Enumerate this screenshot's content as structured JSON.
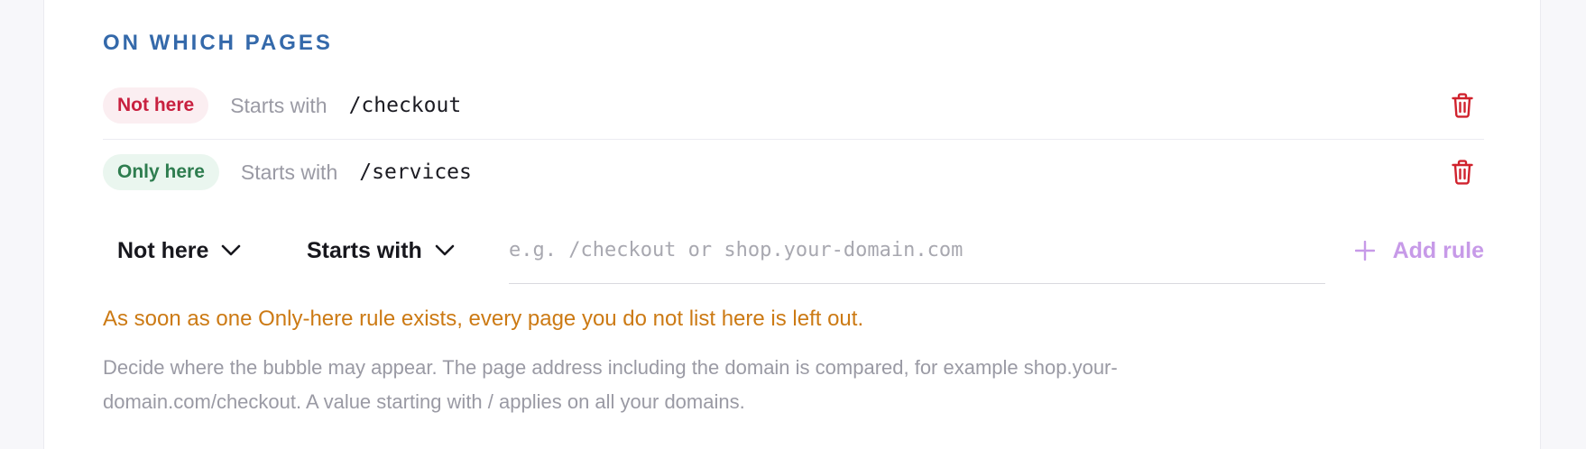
{
  "section": {
    "title": "ON WHICH PAGES"
  },
  "rules": [
    {
      "mode": "Not here",
      "operator": "Starts with",
      "value": "/checkout",
      "delete_icon": "trash-icon"
    },
    {
      "mode": "Only here",
      "operator": "Starts with",
      "value": "/services",
      "delete_icon": "trash-icon"
    }
  ],
  "new_rule": {
    "mode_selected": "Not here",
    "operator_selected": "Starts with",
    "placeholder": "e.g. /checkout or shop.your-domain.com",
    "value": "",
    "add_label": "Add rule",
    "add_icon": "plus-icon",
    "chevron_icon": "chevron-down-icon"
  },
  "warning": "As soon as one Only-here rule exists, every page you do not list here is left out.",
  "help_text": "Decide where the bubble may appear. The page address including the domain is compared, for example shop.your-domain.com/checkout. A value starting with / applies on all your domains.",
  "colors": {
    "title": "#3469aa",
    "not_here": "#c8203f",
    "only_here": "#2e7d4f",
    "delete": "#d0222d",
    "add_rule": "#c79ae8",
    "warning": "#cc7a14"
  }
}
